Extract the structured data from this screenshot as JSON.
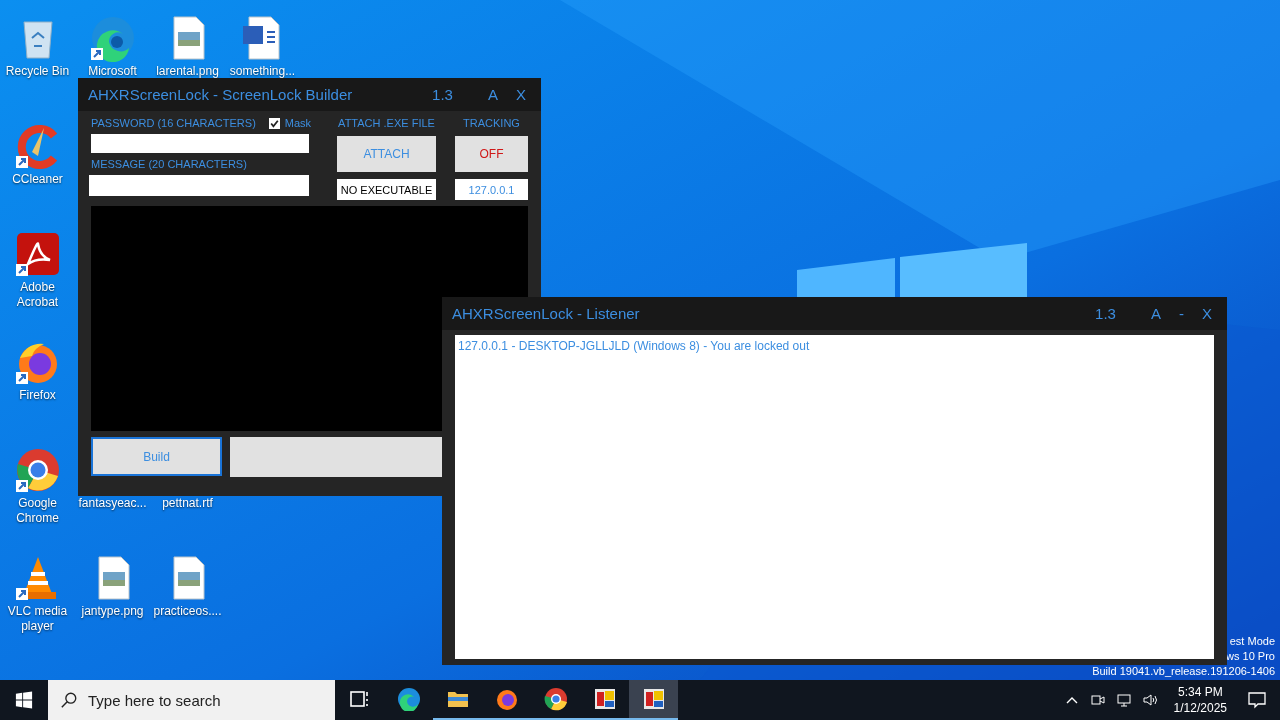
{
  "desktop_icons": [
    {
      "label": "Recycle Bin",
      "kind": "recycle",
      "shortcut": false
    },
    {
      "label": "Microsoft",
      "kind": "edge",
      "shortcut": true
    },
    {
      "label": "larental.png",
      "kind": "image",
      "shortcut": false
    },
    {
      "label": "something...",
      "kind": "word",
      "shortcut": false
    },
    {
      "label": "CCleaner",
      "kind": "ccleaner",
      "shortcut": true
    },
    {
      "label": "Adobe Acrobat",
      "kind": "acrobat",
      "shortcut": true
    },
    {
      "label": "Firefox",
      "kind": "firefox",
      "shortcut": true
    },
    {
      "label": "Google Chrome",
      "kind": "chrome",
      "shortcut": true
    },
    {
      "label": "fantasyeac...",
      "kind": "hidden"
    },
    {
      "label": "pettnat.rtf",
      "kind": "hidden"
    },
    {
      "label": "VLC media player",
      "kind": "vlc",
      "shortcut": true
    },
    {
      "label": "jantype.png",
      "kind": "image",
      "shortcut": false
    },
    {
      "label": "practiceos....",
      "kind": "image",
      "shortcut": false
    }
  ],
  "watermark_lines": [
    "est Mode",
    "ws 10 Pro",
    "Build 19041.vb_release.191206-1406"
  ],
  "builder": {
    "title": "AHXRScreenLock - ScreenLock Builder",
    "version": "1.3",
    "buttons": [
      "A",
      "X"
    ],
    "password_label": "PASSWORD (16 CHARACTERS)",
    "mask": {
      "label": "Mask",
      "checked": true
    },
    "message_label": "MESSAGE (20 CHARACTERS)",
    "attach_label": "ATTACH .EXE FILE",
    "attach_button": "ATTACH",
    "executable": "NO EXECUTABLE",
    "tracking_label": "TRACKING",
    "tracking_button": "OFF",
    "tracking_on": false,
    "tracking_ip": "127.0.0.1",
    "build_button": {
      "label": "Build",
      "focused": true
    }
  },
  "listener": {
    "title": "AHXRScreenLock - Listener",
    "version": "1.3",
    "buttons": [
      "A",
      "-",
      "X"
    ],
    "log": [
      "127.0.0.1 - DESKTOP-JGLLJLD (Windows 8) - You are locked out"
    ]
  },
  "taskbar": {
    "search": {
      "placeholder": "Type here to search"
    },
    "apps": [
      {
        "kind": "taskview",
        "running": false,
        "selected": false
      },
      {
        "kind": "edge",
        "running": false,
        "selected": false
      },
      {
        "kind": "explorer",
        "running": true,
        "selected": false
      },
      {
        "kind": "firefox",
        "running": true,
        "selected": false
      },
      {
        "kind": "chrome",
        "running": true,
        "selected": false
      },
      {
        "kind": "app",
        "running": true,
        "selected": false
      },
      {
        "kind": "app",
        "running": true,
        "selected": true
      }
    ],
    "time": "5:34 PM",
    "date": "1/12/2025"
  }
}
